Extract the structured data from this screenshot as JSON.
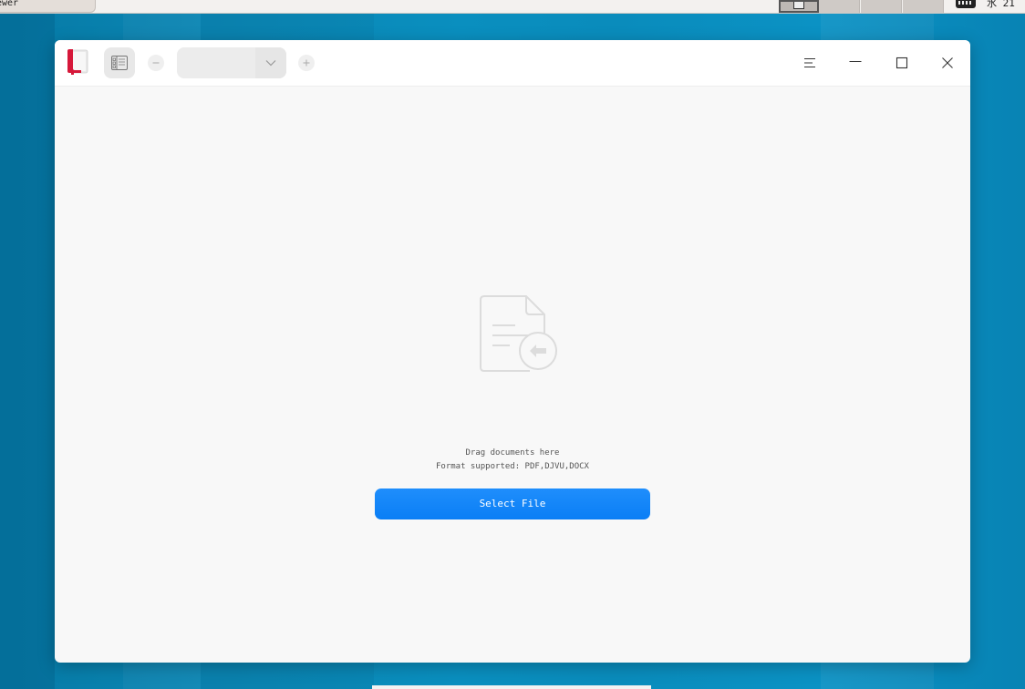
{
  "taskbar": {
    "window_tab_label": "ewer",
    "clock_text": "水 21"
  },
  "window": {
    "zoom_value": "",
    "empty_state": {
      "drag_hint": "Drag documents here",
      "formats_hint": "Format supported: PDF,DJVU,DOCX",
      "select_button_label": "Select File"
    }
  },
  "colors": {
    "accent": "#0a7ef5",
    "logo_red": "#d6183a",
    "icon_gray": "#dcdcdc"
  },
  "icons": {
    "logo": "document-viewer-logo",
    "thumbnails": "thumbnail-panel-icon",
    "zoom_out": "minus-icon",
    "zoom_in": "plus-icon",
    "dropdown": "chevron-down-icon",
    "menu": "hamburger-menu-icon",
    "minimize": "minimize-icon",
    "maximize": "maximize-icon",
    "close": "close-icon",
    "empty": "document-import-icon"
  }
}
